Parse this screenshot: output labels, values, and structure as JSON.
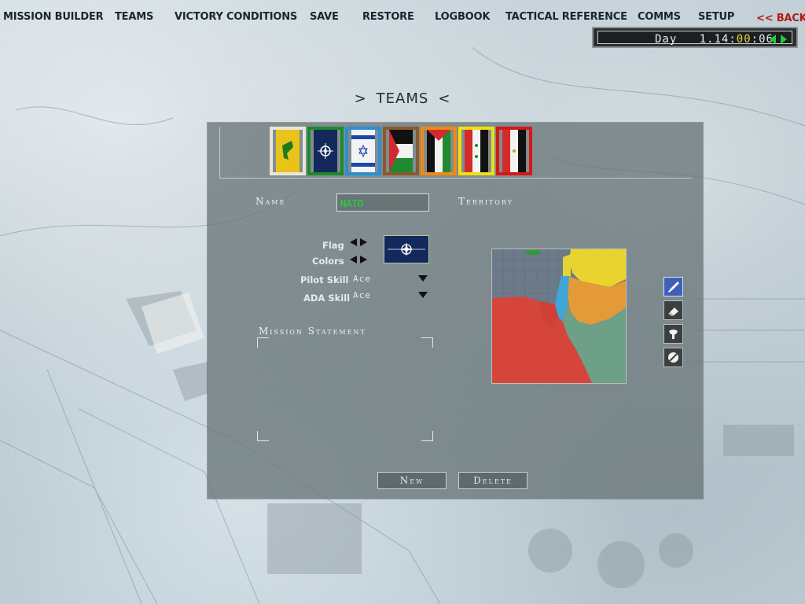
{
  "nav": {
    "items": [
      "MISSION BUILDER",
      "TEAMS",
      "VICTORY CONDITIONS",
      "SAVE",
      "RESTORE",
      "LOGBOOK",
      "TACTICAL REFERENCE",
      "COMMS",
      "SETUP"
    ],
    "back": "<< BACK"
  },
  "clock": {
    "day_label": "Day",
    "day": "1",
    "hours": "14",
    "minutes": "00",
    "seconds": "06"
  },
  "title": {
    "left": ">",
    "text": "TEAMS",
    "right": "<"
  },
  "teams": {
    "flags": [
      {
        "name": "hezbollah",
        "frame_color": "#e8e6d8"
      },
      {
        "name": "nato",
        "frame_color": "#1d8a2a"
      },
      {
        "name": "israel",
        "frame_color": "#2b8fd6"
      },
      {
        "name": "palestine",
        "frame_color": "#8a5a2a"
      },
      {
        "name": "jordan",
        "frame_color": "#f08a12"
      },
      {
        "name": "syria",
        "frame_color": "#f2df12"
      },
      {
        "name": "egypt",
        "frame_color": "#d41818"
      }
    ],
    "selected": "nato"
  },
  "form": {
    "name_label": "Name",
    "name_value": "NATO",
    "territory_label": "Territory",
    "flag_label": "Flag",
    "colors_label": "Colors",
    "pilot_skill_label": "Pilot Skill",
    "pilot_skill_value": "Ace",
    "ada_skill_label": "ADA Skill",
    "ada_skill_value": "Ace",
    "mission_statement_label": "Mission Statement",
    "mission_statement_value": ""
  },
  "territory_tools": [
    "paint-brush",
    "eraser",
    "bucket",
    "clear"
  ],
  "buttons": {
    "new": "New",
    "delete": "Delete"
  },
  "colors": {
    "map_red": "#d6453c",
    "map_yellow": "#e9d32e",
    "map_orange": "#e59a38",
    "map_green": "#6ea088",
    "map_blue": "#3ea6d8",
    "map_water": "#6c7a8a"
  }
}
